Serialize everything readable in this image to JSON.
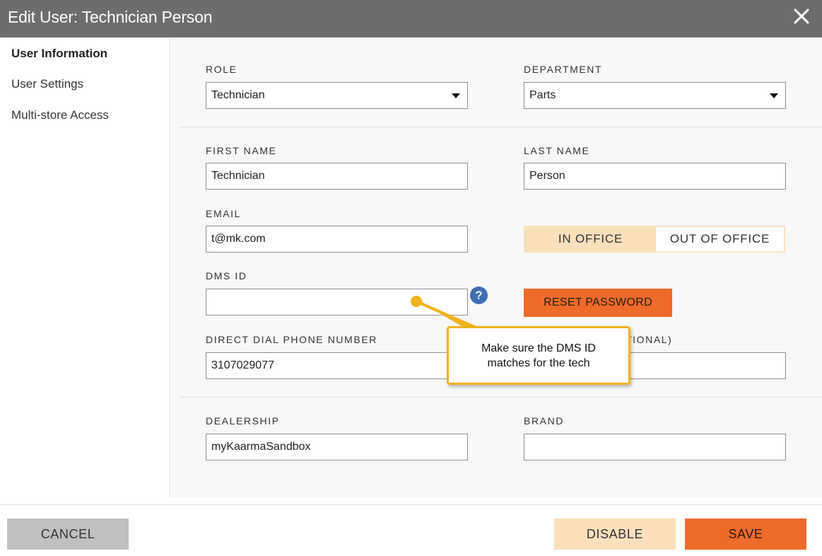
{
  "window": {
    "title": "Edit User: Technician Person",
    "close_icon": "close-icon"
  },
  "sidebar": {
    "items": [
      {
        "label": "User Information",
        "active": true
      },
      {
        "label": "User Settings",
        "active": false
      },
      {
        "label": "Multi-store Access",
        "active": false
      }
    ]
  },
  "form": {
    "role": {
      "label": "ROLE",
      "value": "Technician"
    },
    "department": {
      "label": "DEPARTMENT",
      "value": "Parts"
    },
    "first_name": {
      "label": "FIRST NAME",
      "value": "Technician"
    },
    "last_name": {
      "label": "LAST NAME",
      "value": "Person"
    },
    "email": {
      "label": "EMAIL",
      "value": "t@mk.com"
    },
    "office_toggle": {
      "in_label": "IN OFFICE",
      "out_label": "OUT OF OFFICE",
      "selected": "IN OFFICE"
    },
    "dms_id": {
      "label": "DMS ID",
      "value": "",
      "help_icon": "?"
    },
    "reset_password_label": "RESET PASSWORD",
    "direct_dial": {
      "label": "DIRECT DIAL PHONE NUMBER",
      "value": "3107029077"
    },
    "optional_field": {
      "label_visible_fragment": "TIONAL)",
      "value": ""
    },
    "dealership": {
      "label": "DEALERSHIP",
      "value": "myKaarmaSandbox"
    },
    "brand": {
      "label": "BRAND",
      "value": ""
    }
  },
  "callout": {
    "line1": "Make sure the DMS ID",
    "line2": "matches for the tech"
  },
  "footer": {
    "cancel_label": "CANCEL",
    "disable_label": "DISABLE",
    "save_label": "SAVE"
  },
  "colors": {
    "titlebar": "#6d6d6d",
    "accent_orange": "#ee6b2a",
    "accent_peach": "#fbe0bb",
    "callout_border": "#f2b21e",
    "help_blue": "#3f6db4"
  }
}
